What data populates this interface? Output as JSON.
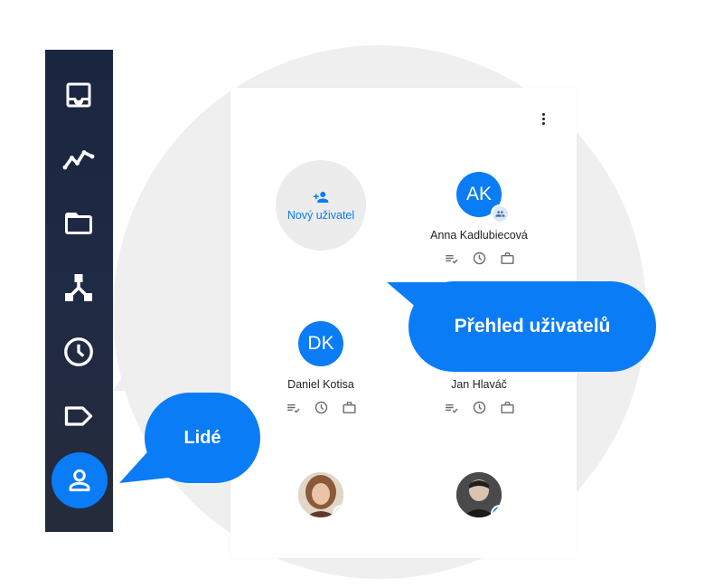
{
  "sidebar": {
    "items": [
      {
        "icon": "inbox-icon"
      },
      {
        "icon": "activity-chart-icon"
      },
      {
        "icon": "folder-icon"
      },
      {
        "icon": "hierarchy-icon"
      },
      {
        "icon": "clock-icon"
      },
      {
        "icon": "tag-icon"
      },
      {
        "icon": "person-icon",
        "active": true
      }
    ]
  },
  "panel": {
    "new_user_label": "Nový uživatel",
    "users": [
      {
        "initials": "AK",
        "name": "Anna Kadlubiecová",
        "badge": "group"
      },
      {
        "initials": "DK",
        "name": "Daniel Kotisa"
      },
      {
        "name": "Jan Hlaváč"
      },
      {
        "photo": true,
        "badge": "group"
      },
      {
        "photo": true,
        "badge": "group-blue"
      }
    ],
    "action_icons": [
      "tasks-icon",
      "clock-icon",
      "briefcase-icon"
    ]
  },
  "callouts": {
    "users_overview": "Přehled uživatelů",
    "people": "Lidé"
  },
  "colors": {
    "accent": "#0a7cf5",
    "sidebar": "#1f2a44",
    "background_circle": "#efefef"
  }
}
